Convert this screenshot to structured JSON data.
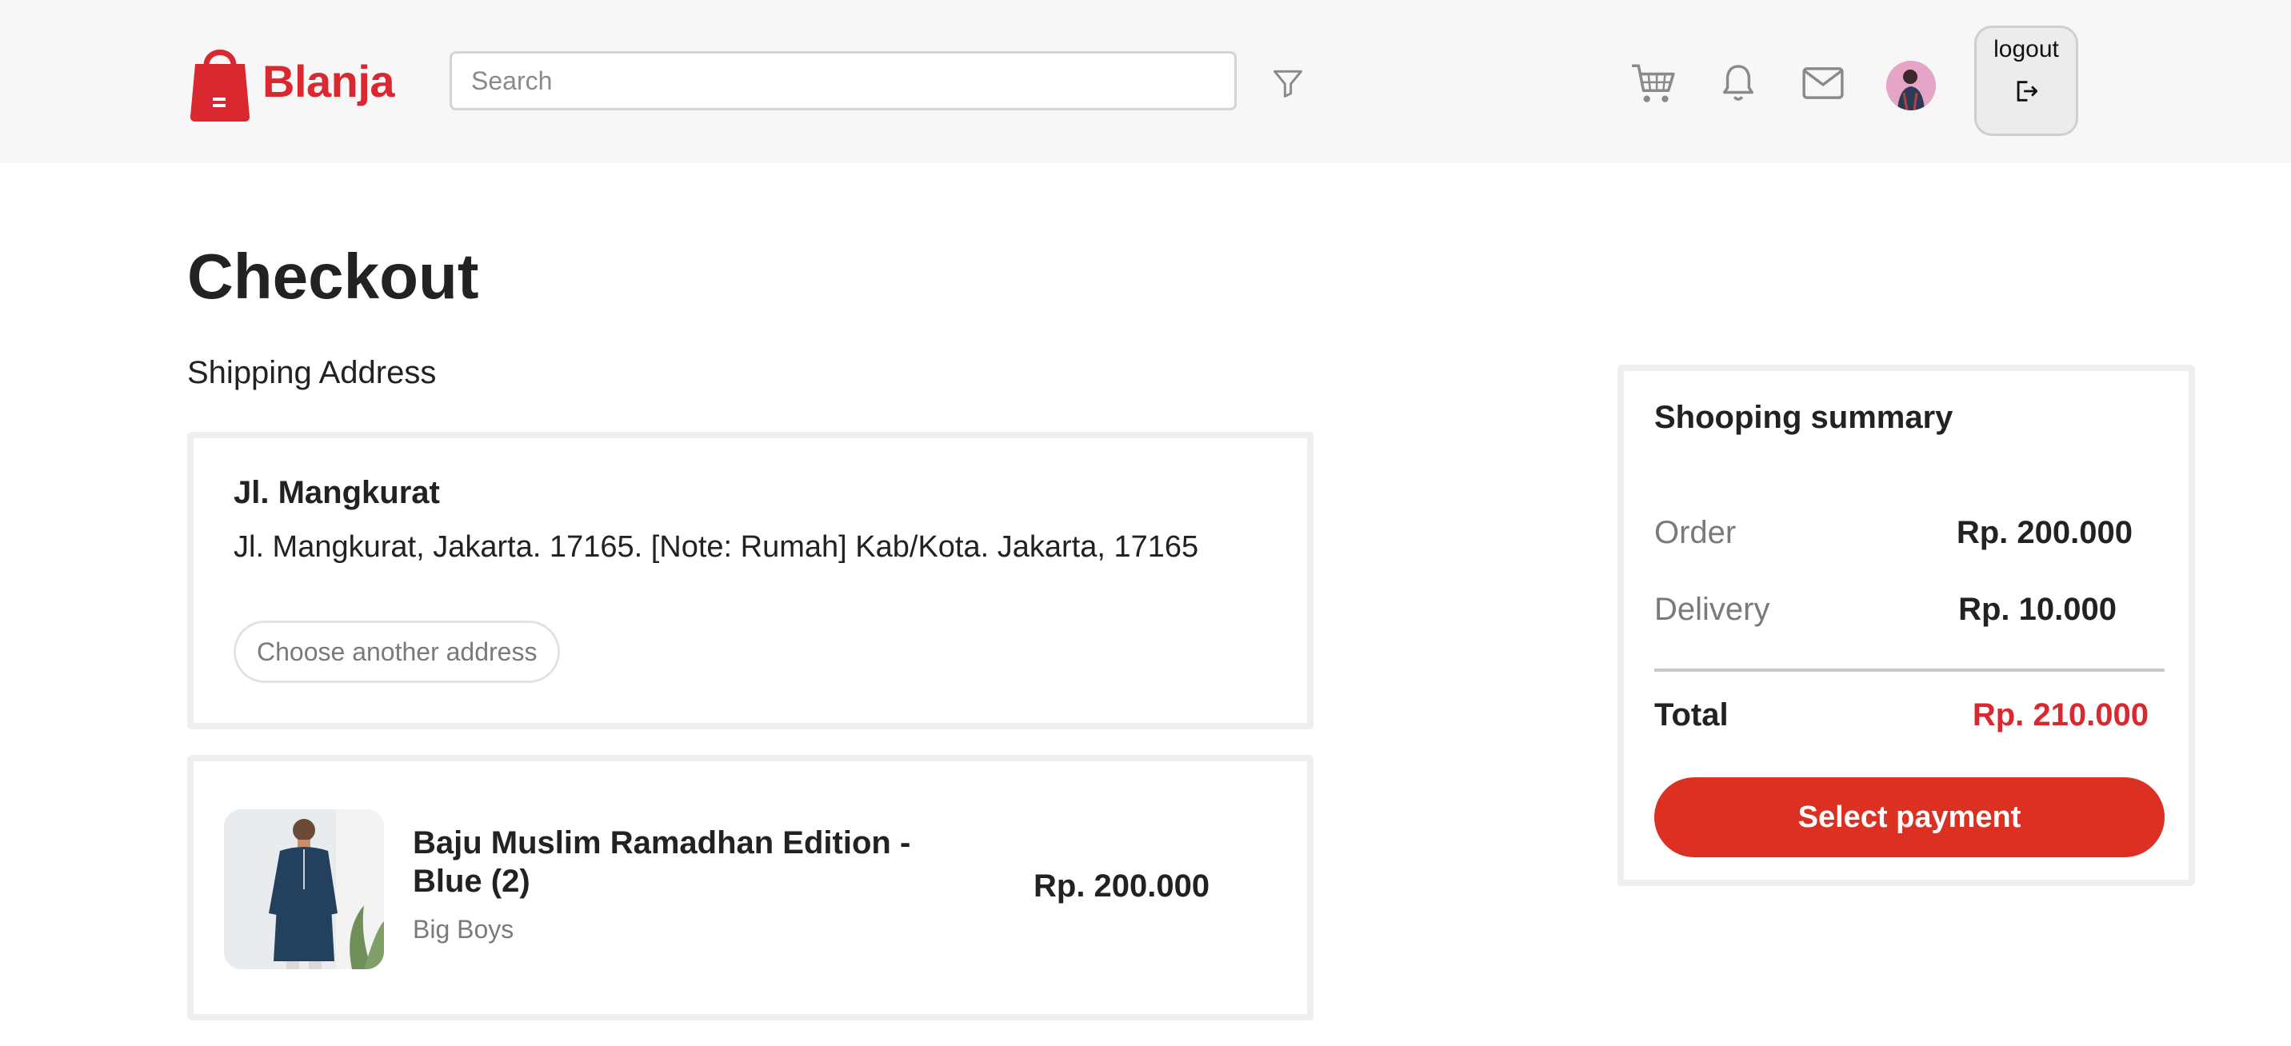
{
  "brand": {
    "name": "Blanja",
    "color": "#d9282f"
  },
  "header": {
    "search_placeholder": "Search",
    "logout_label": "logout",
    "icons": [
      "filter-icon",
      "cart-icon",
      "bell-icon",
      "mail-icon",
      "logout-icon"
    ]
  },
  "page": {
    "title": "Checkout",
    "section_title": "Shipping Address"
  },
  "address": {
    "name": "Jl. Mangkurat",
    "detail": "Jl. Mangkurat, Jakarta. 17165. [Note: Rumah] Kab/Kota. Jakarta, 17165",
    "choose_label": "Choose another address"
  },
  "product": {
    "name": "Baju Muslim Ramadhan Edition - Blue (2)",
    "store": "Big Boys",
    "price": "Rp. 200.000"
  },
  "summary": {
    "title": "Shooping summary",
    "order_label": "Order",
    "order_value": "Rp. 200.000",
    "delivery_label": "Delivery",
    "delivery_value": "Rp. 10.000",
    "total_label": "Total",
    "total_value": "Rp. 210.000",
    "pay_label": "Select payment"
  },
  "colors": {
    "accent": "#db3022",
    "total": "#d9282f",
    "muted": "#7a7a7a"
  }
}
